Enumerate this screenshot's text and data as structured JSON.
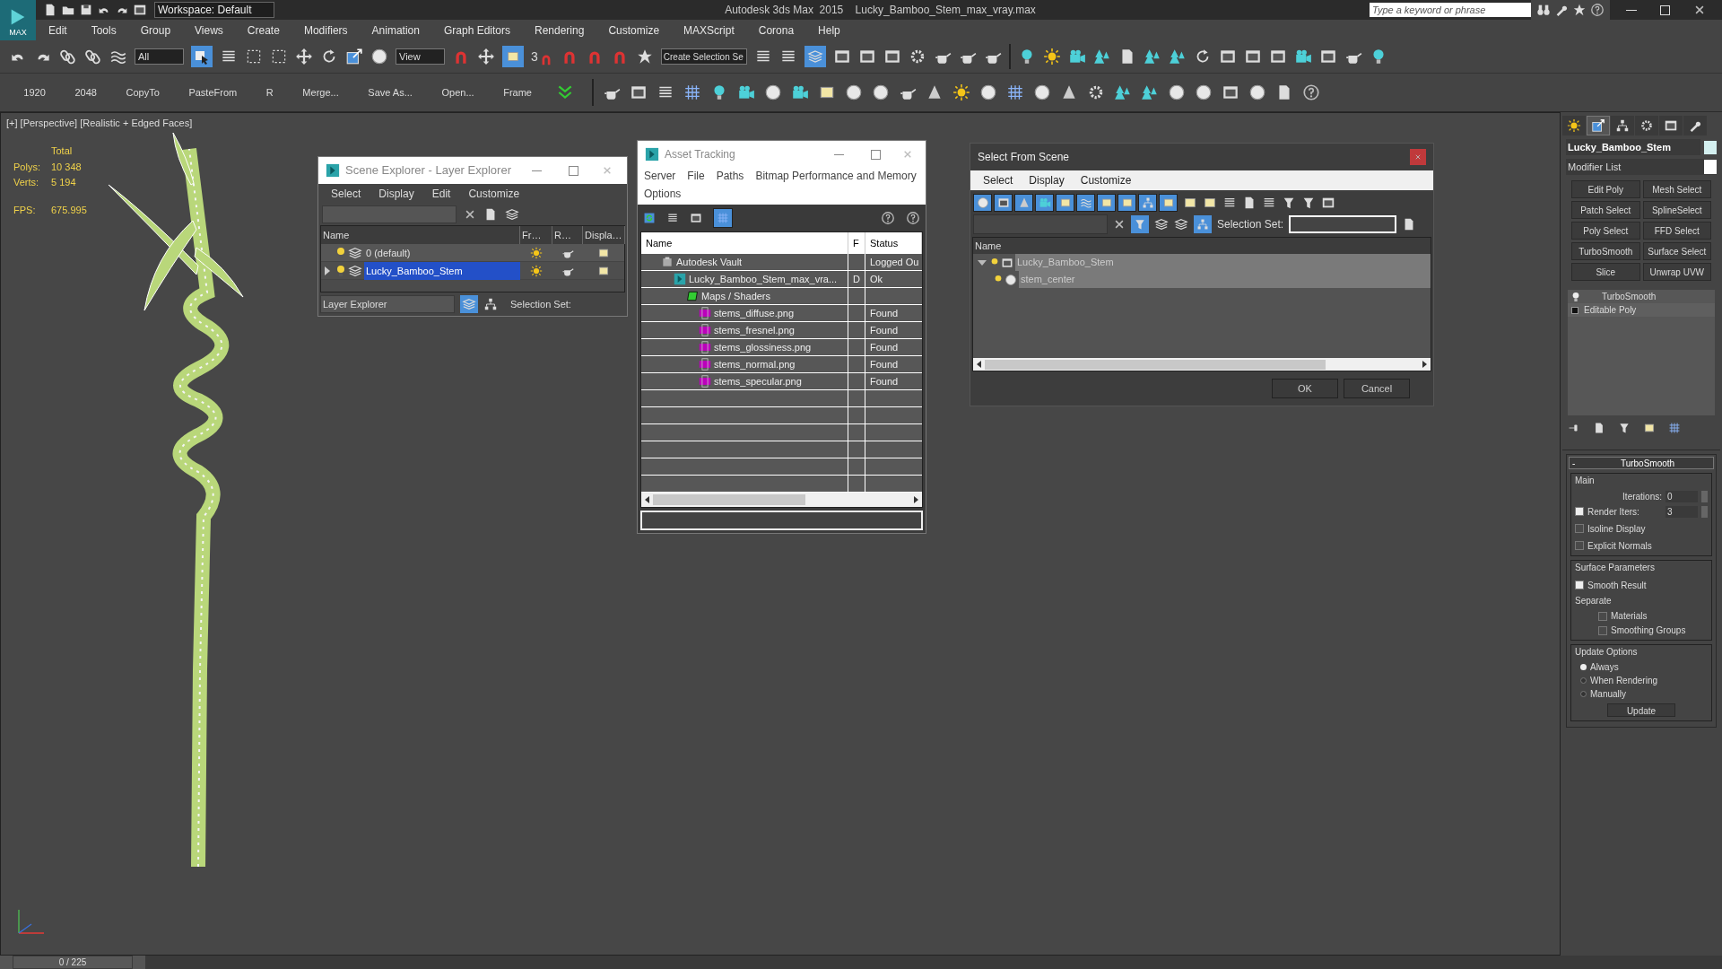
{
  "title_bar": {
    "workspace": "Workspace: Default",
    "title": "Autodesk 3ds Max  2015    Lucky_Bamboo_Stem_max_vray.max",
    "search_placeholder": "Type a keyword or phrase"
  },
  "logo": "MAX",
  "menu_bar": [
    "Edit",
    "Tools",
    "Group",
    "Views",
    "Create",
    "Modifiers",
    "Animation",
    "Graph Editors",
    "Rendering",
    "Customize",
    "MAXScript",
    "Corona",
    "Help"
  ],
  "main_toolbar": {
    "selection_filter": "All",
    "reference_coordinate": "View",
    "snap_value": "3",
    "named_selection": "Create Selection Se"
  },
  "command_toolbar": [
    "1920",
    "2048",
    "CopyTo",
    "PasteFrom",
    "R",
    "Merge...",
    "Save As...",
    "Open...",
    "Frame"
  ],
  "viewport": {
    "label": "[+] [Perspective] [Realistic + Edged Faces]",
    "stats_header": "Total",
    "stats": [
      {
        "label": "Polys:",
        "value": "10 348"
      },
      {
        "label": "Verts:",
        "value": "5 194"
      },
      {
        "label": "FPS:",
        "value": "675.995"
      }
    ]
  },
  "scene_explorer": {
    "title": "Scene Explorer - Layer Explorer",
    "menus": [
      "Select",
      "Display",
      "Edit",
      "Customize"
    ],
    "columns": [
      "Name",
      "Fr…",
      "R…",
      "Displa…"
    ],
    "rows": [
      {
        "name": "0 (default)",
        "selected": false
      },
      {
        "name": "Lucky_Bamboo_Stem",
        "selected": true
      }
    ],
    "explorer_type": "Layer Explorer",
    "selection_set_label": "Selection Set:"
  },
  "asset_tracking": {
    "title": "Asset Tracking",
    "menus": [
      "Server",
      "File",
      "Paths",
      "Bitmap Performance and Memory",
      "Options"
    ],
    "columns": [
      "Name",
      "F",
      "Status"
    ],
    "rows": [
      {
        "name": "Autodesk Vault",
        "kind": "vault",
        "status": "Logged Ou",
        "children": [
          {
            "name": "Lucky_Bamboo_Stem_max_vra...",
            "kind": "scene",
            "flag": "D",
            "status": "Ok",
            "children": [
              {
                "name": "Maps / Shaders",
                "kind": "folder",
                "children": [
                  {
                    "name": "stems_diffuse.png",
                    "kind": "png",
                    "status": "Found"
                  },
                  {
                    "name": "stems_fresnel.png",
                    "kind": "png",
                    "status": "Found"
                  },
                  {
                    "name": "stems_glossiness.png",
                    "kind": "png",
                    "status": "Found"
                  },
                  {
                    "name": "stems_normal.png",
                    "kind": "png",
                    "status": "Found"
                  },
                  {
                    "name": "stems_specular.png",
                    "kind": "png",
                    "status": "Found"
                  }
                ]
              }
            ]
          }
        ]
      }
    ]
  },
  "select_from_scene": {
    "title": "Select From Scene",
    "menus": [
      "Select",
      "Display",
      "Customize"
    ],
    "selection_set_label": "Selection Set:",
    "column": "Name",
    "tree": [
      {
        "name": "Lucky_Bamboo_Stem",
        "expanded": true,
        "children": [
          {
            "name": "stem_center"
          }
        ]
      }
    ],
    "buttons": [
      "OK",
      "Cancel"
    ]
  },
  "command_panel": {
    "tabs": [
      {
        "selected": false
      },
      {
        "selected": true
      },
      {
        "selected": false
      },
      {
        "selected": false
      },
      {
        "selected": false
      },
      {
        "selected": false
      }
    ],
    "object_name": "Lucky_Bamboo_Stem",
    "modifier_list": "Modifier List",
    "modifier_buttons": [
      "Edit Poly",
      "Mesh Select",
      "Patch Select",
      "SplineSelect",
      "Poly Select",
      "FFD Select",
      "TurboSmooth",
      "Surface Select",
      "Slice",
      "Unwrap UVW"
    ],
    "stack": [
      {
        "name": "TurboSmooth",
        "kind": "modifier"
      },
      {
        "name": "Editable Poly",
        "kind": "base"
      }
    ],
    "rollout": {
      "title": "TurboSmooth",
      "collapse": "-",
      "groups": [
        {
          "title": "Main",
          "items": [
            {
              "kind": "spinner",
              "label": "Iterations:",
              "value": "0"
            },
            {
              "kind": "check_spinner",
              "label": "Render Iters:",
              "value": "3",
              "checked": true
            },
            {
              "kind": "checkbox",
              "label": "Isoline Display",
              "checked": false
            },
            {
              "kind": "checkbox",
              "label": "Explicit Normals",
              "checked": false
            }
          ]
        },
        {
          "title": "Surface Parameters",
          "items": [
            {
              "kind": "checkbox",
              "label": "Smooth Result",
              "checked": true
            },
            {
              "kind": "label",
              "label": "Separate"
            },
            {
              "kind": "subcheckbox",
              "label": "Materials",
              "checked": false
            },
            {
              "kind": "subcheckbox",
              "label": "Smoothing Groups",
              "checked": false
            }
          ]
        },
        {
          "title": "Update Options",
          "items": [
            {
              "kind": "radio",
              "label": "Always",
              "selected": true
            },
            {
              "kind": "radio",
              "label": "When Rendering",
              "selected": false
            },
            {
              "kind": "radio",
              "label": "Manually",
              "selected": false
            },
            {
              "kind": "button",
              "label": "Update"
            }
          ]
        }
      ]
    }
  },
  "time_slider": {
    "position": "0 / 225"
  }
}
